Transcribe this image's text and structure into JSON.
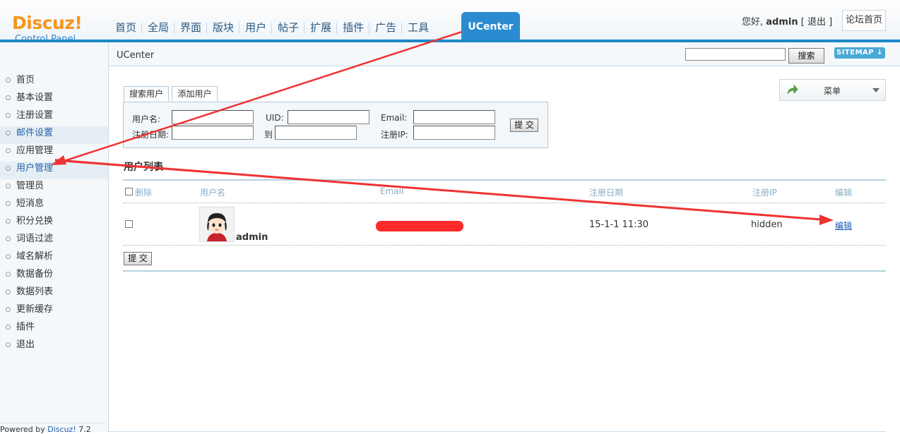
{
  "logo": {
    "main": "Discuz",
    "bang": "!",
    "sub": "Control Panel"
  },
  "nav": {
    "items": [
      "首页",
      "全局",
      "界面",
      "版块",
      "用户",
      "帖子",
      "扩展",
      "插件",
      "广告",
      "工具"
    ],
    "active": "UCenter"
  },
  "user": {
    "greeting": "您好,",
    "name": "admin",
    "bracket_open": "[",
    "logout": "退出",
    "bracket_close": "]",
    "forum_home": "论坛首页"
  },
  "subbar": {
    "title": "UCenter",
    "search_button": "搜索",
    "sitemap": "SITEMAP"
  },
  "sidebar": {
    "items": [
      "首页",
      "基本设置",
      "注册设置",
      "邮件设置",
      "应用管理",
      "用户管理",
      "管理员",
      "短消息",
      "积分兑换",
      "词语过滤",
      "域名解析",
      "数据备份",
      "数据列表",
      "更新缓存",
      "插件",
      "退出"
    ],
    "highlighted": [
      "邮件设置",
      "用户管理"
    ],
    "powered_prefix": "Powered by",
    "powered_brand": "Discuz!",
    "powered_version": "7.2"
  },
  "menu_dropdown": {
    "label": "菜单"
  },
  "tabs": [
    "搜索用户",
    "添加用户"
  ],
  "search_form": {
    "username_label": "用户名:",
    "uid_label": "UID:",
    "email_label": "Email:",
    "regdate_label": "注册日期:",
    "to_label": "到",
    "regip_label": "注册IP:",
    "submit": "提 交"
  },
  "user_list": {
    "title": "用户列表",
    "headers": {
      "delete": "删除",
      "username": "用户名",
      "email": "Email",
      "regdate": "注册日期",
      "regip": "注册IP",
      "edit": "编辑"
    },
    "rows": [
      {
        "username": "admin",
        "email": "[redacted]",
        "regdate": "15-1-1 11:30",
        "regip": "hidden",
        "edit": "编辑"
      }
    ],
    "submit": "提 交"
  },
  "colors": {
    "accent": "#2b8bd0",
    "logo": "#f7941d",
    "annotation_arrow": "#ee3333"
  }
}
